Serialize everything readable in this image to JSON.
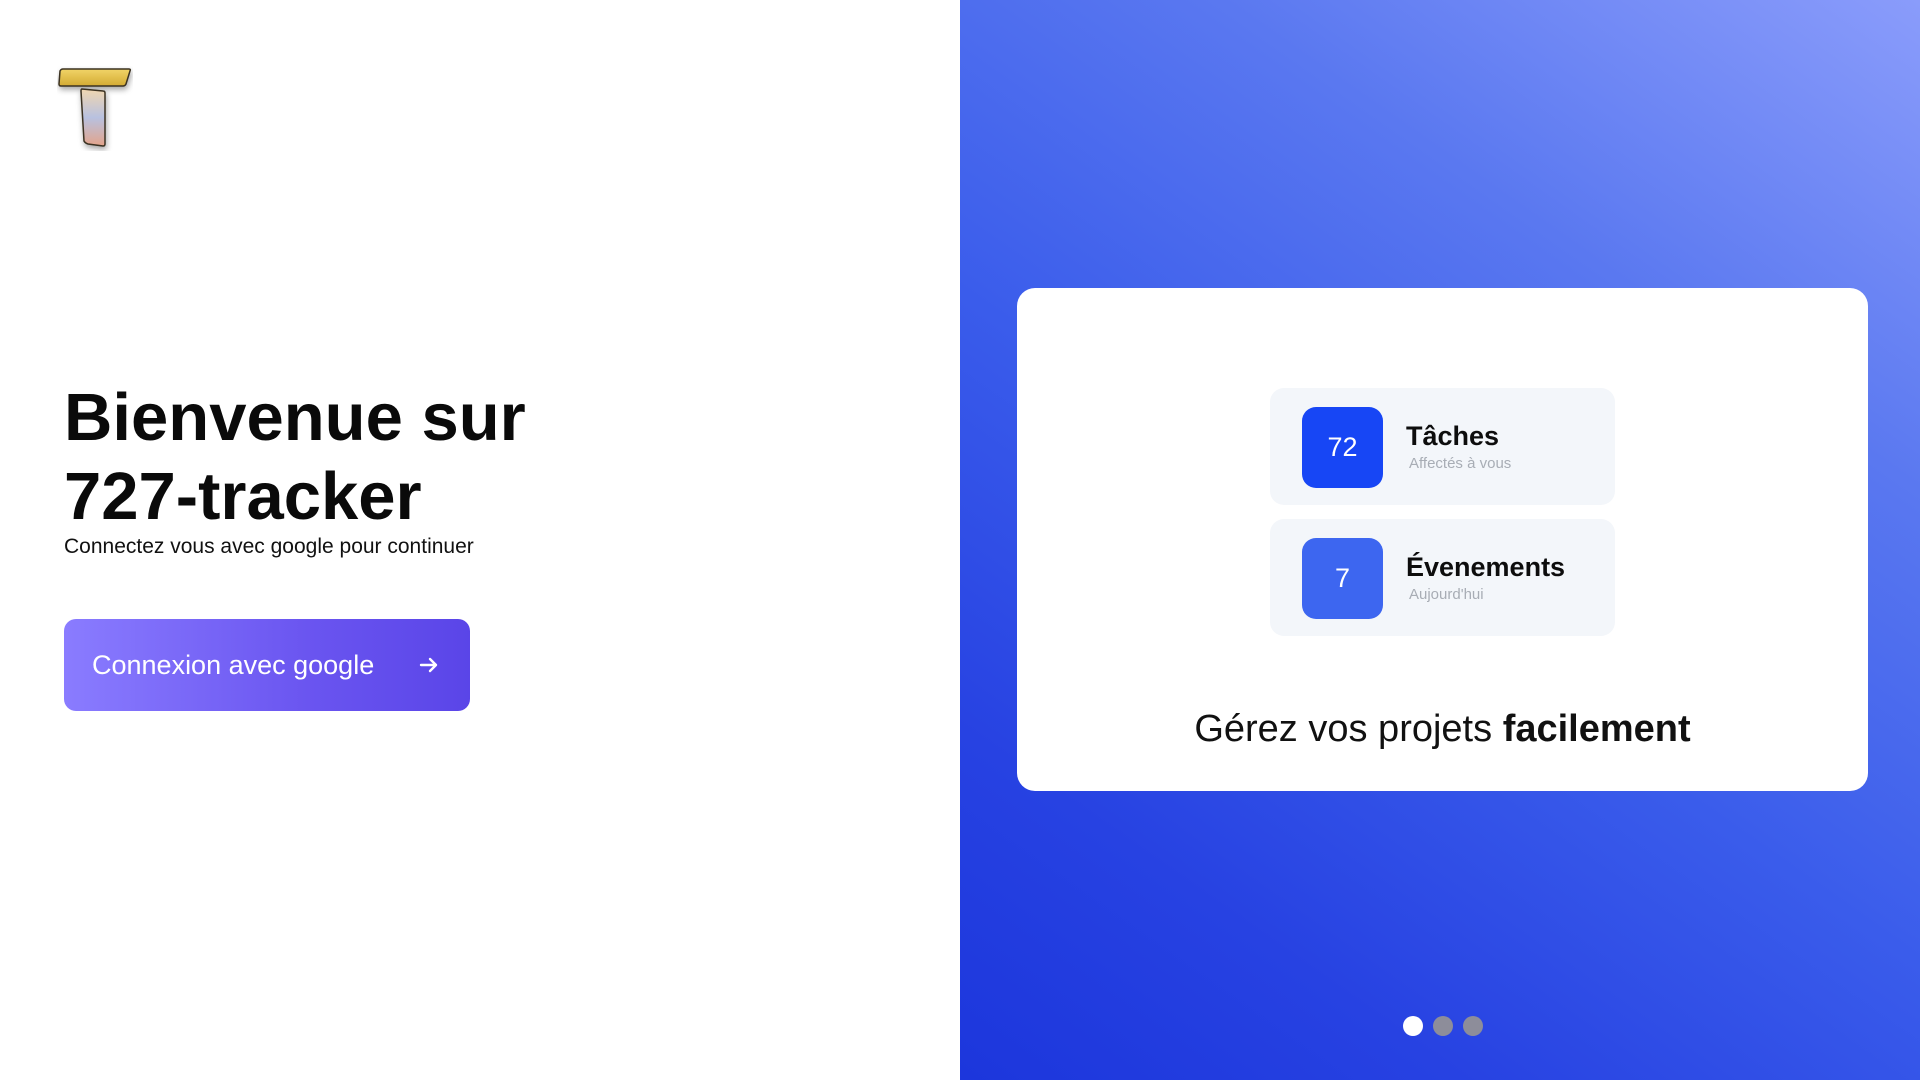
{
  "app": {
    "logo_icon": "t-letter-logo-icon"
  },
  "welcome": {
    "headline_line1": "Bienvenue sur",
    "headline_line2": "727-tracker",
    "subtitle": "Connectez vous avec google pour continuer"
  },
  "login_button": {
    "label": "Connexion avec google",
    "icon": "arrow-right-icon"
  },
  "showcase": {
    "stats": [
      {
        "value": "72",
        "title": "Tâches",
        "caption": "Affectés à vous"
      },
      {
        "value": "7",
        "title": "Évenements",
        "caption": "Aujourd'hui"
      }
    ],
    "tagline_light": "Gérez vos projets",
    "tagline_bold": "facilement"
  },
  "carousel": {
    "count": 3,
    "active_index": 0
  },
  "colors": {
    "button_gradient_start": "#8a7cff",
    "button_gradient_end": "#5a45e8",
    "panel_gradient_light": "#8a9cfb",
    "panel_gradient_dark": "#1c36dc",
    "stat_tasks_color": "#1746f5",
    "stat_events_color": "#3d66f0"
  }
}
